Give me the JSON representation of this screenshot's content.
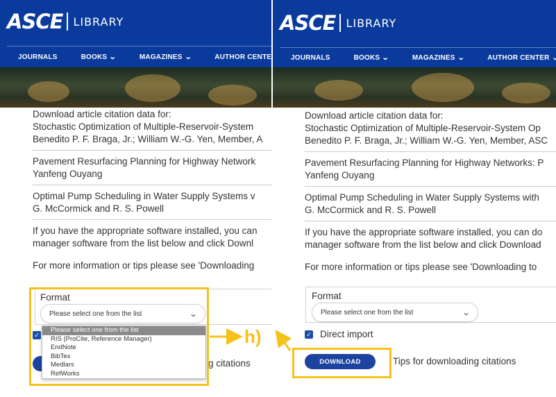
{
  "brand": {
    "logo_text": "ASCE",
    "library_text": "LIBRARY"
  },
  "nav": [
    {
      "label": "JOURNALS",
      "has_dropdown": false
    },
    {
      "label": "BOOKS",
      "has_dropdown": true
    },
    {
      "label": "MAGAZINES",
      "has_dropdown": true
    },
    {
      "label": "AUTHOR CENTER",
      "has_dropdown": true
    }
  ],
  "colors": {
    "header": "#0a3a9c",
    "button": "#1c43a0",
    "highlight": "#f4c21b"
  },
  "left": {
    "intro": "Download article citation data for:",
    "articles": [
      {
        "title": "Stochastic Optimization of Multiple-Reservoir-System",
        "authors": "Benedito P. F. Braga, Jr.; William W.-G. Yen, Member, A"
      },
      {
        "title": "Pavement Resurfacing Planning for Highway Network",
        "authors": "Yanfeng Ouyang"
      },
      {
        "title": "Optimal Pump Scheduling in Water Supply Systems v",
        "authors": "G. McCormick and R. S. Powell"
      }
    ],
    "software_line1": "If you have the appropriate software installed, you can",
    "software_line2": "manager software from the list below and click Downl",
    "info": "For more information or tips please see 'Downloading",
    "format_label": "Format",
    "select_value": "Please select one from the list",
    "dropdown_options": [
      "Please select one from the list",
      "RIS (ProCite, Reference Manager)",
      "EndNote",
      "BibTex",
      "Medlars",
      "RefWorks"
    ],
    "tips_visible": "g citations"
  },
  "right": {
    "intro": "Download article citation data for:",
    "articles": [
      {
        "title": "Stochastic Optimization of Multiple-Reservoir-System Op",
        "authors": "Benedito P. F. Braga, Jr.; William W.-G. Yen, Member, ASC"
      },
      {
        "title": "Pavement Resurfacing Planning for Highway Networks: P",
        "authors": "Yanfeng Ouyang"
      },
      {
        "title": "Optimal Pump Scheduling in Water Supply Systems with",
        "authors": "G. McCormick and R. S. Powell"
      }
    ],
    "software_line1": "If you have the appropriate software installed, you can do",
    "software_line2": "manager software from the list below and click Download",
    "info": "For more information or tips please see 'Downloading to",
    "format_label": "Format",
    "select_value": "Please select one from the list",
    "direct_import_label": "Direct import",
    "download_label": "DOWNLOAD",
    "tips": "Tips for downloading citations"
  },
  "annotation": {
    "label": "h)"
  }
}
